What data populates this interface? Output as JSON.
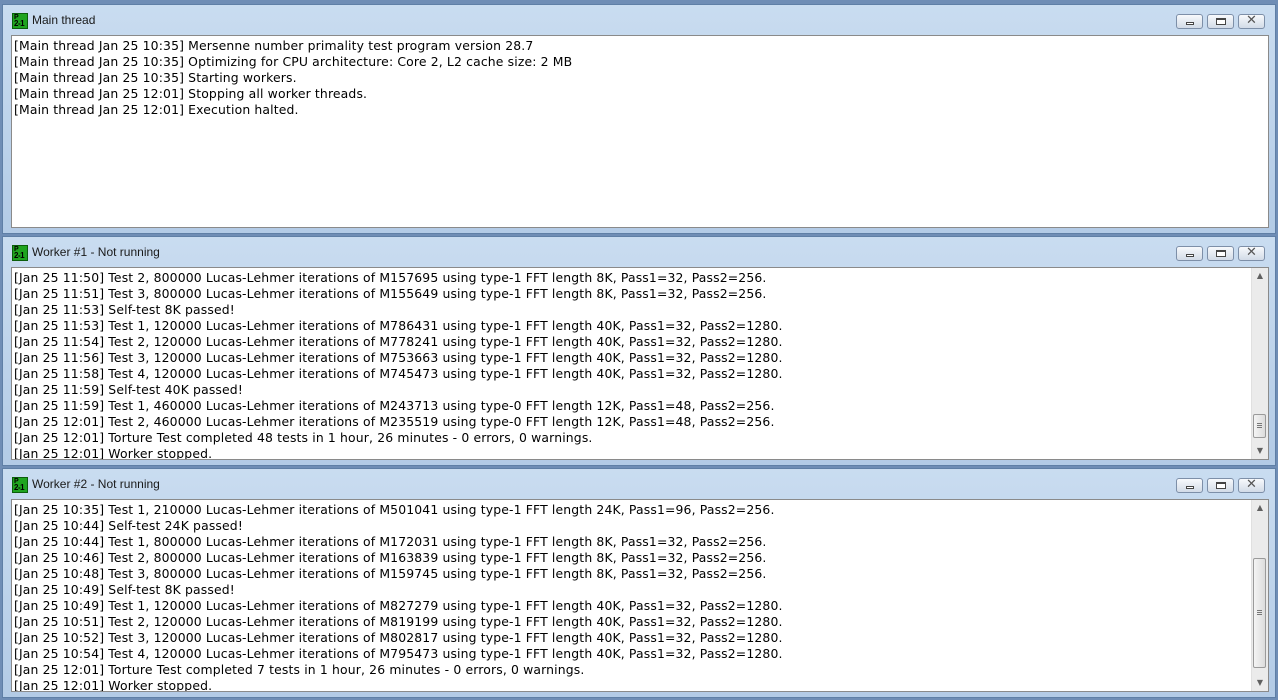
{
  "windows": [
    {
      "title": "Main thread",
      "lines": [
        "[Main thread Jan 25 10:35] Mersenne number primality test program version 28.7",
        "[Main thread Jan 25 10:35] Optimizing for CPU architecture: Core 2, L2 cache size: 2 MB",
        "[Main thread Jan 25 10:35] Starting workers.",
        "[Main thread Jan 25 12:01] Stopping all worker threads.",
        "[Main thread Jan 25 12:01] Execution halted."
      ]
    },
    {
      "title": "Worker #1 - Not running",
      "lines": [
        "[Jan 25 11:50] Test 2, 800000 Lucas-Lehmer iterations of M157695 using type-1 FFT length 8K, Pass1=32, Pass2=256.",
        "[Jan 25 11:51] Test 3, 800000 Lucas-Lehmer iterations of M155649 using type-1 FFT length 8K, Pass1=32, Pass2=256.",
        "[Jan 25 11:53] Self-test 8K passed!",
        "[Jan 25 11:53] Test 1, 120000 Lucas-Lehmer iterations of M786431 using type-1 FFT length 40K, Pass1=32, Pass2=1280.",
        "[Jan 25 11:54] Test 2, 120000 Lucas-Lehmer iterations of M778241 using type-1 FFT length 40K, Pass1=32, Pass2=1280.",
        "[Jan 25 11:56] Test 3, 120000 Lucas-Lehmer iterations of M753663 using type-1 FFT length 40K, Pass1=32, Pass2=1280.",
        "[Jan 25 11:58] Test 4, 120000 Lucas-Lehmer iterations of M745473 using type-1 FFT length 40K, Pass1=32, Pass2=1280.",
        "[Jan 25 11:59] Self-test 40K passed!",
        "[Jan 25 11:59] Test 1, 460000 Lucas-Lehmer iterations of M243713 using type-0 FFT length 12K, Pass1=48, Pass2=256.",
        "[Jan 25 12:01] Test 2, 460000 Lucas-Lehmer iterations of M235519 using type-0 FFT length 12K, Pass1=48, Pass2=256.",
        "[Jan 25 12:01] Torture Test completed 48 tests in 1 hour, 26 minutes - 0 errors, 0 warnings.",
        "[Jan 25 12:01] Worker stopped."
      ],
      "scroll_position": 0.98
    },
    {
      "title": "Worker #2 - Not running",
      "lines": [
        "[Jan 25 10:35] Test 1, 210000 Lucas-Lehmer iterations of M501041 using type-1 FFT length 24K, Pass1=96, Pass2=256.",
        "[Jan 25 10:44] Self-test 24K passed!",
        "[Jan 25 10:44] Test 1, 800000 Lucas-Lehmer iterations of M172031 using type-1 FFT length 8K, Pass1=32, Pass2=256.",
        "[Jan 25 10:46] Test 2, 800000 Lucas-Lehmer iterations of M163839 using type-1 FFT length 8K, Pass1=32, Pass2=256.",
        "[Jan 25 10:48] Test 3, 800000 Lucas-Lehmer iterations of M159745 using type-1 FFT length 8K, Pass1=32, Pass2=256.",
        "[Jan 25 10:49] Self-test 8K passed!",
        "[Jan 25 10:49] Test 1, 120000 Lucas-Lehmer iterations of M827279 using type-1 FFT length 40K, Pass1=32, Pass2=1280.",
        "[Jan 25 10:51] Test 2, 120000 Lucas-Lehmer iterations of M819199 using type-1 FFT length 40K, Pass1=32, Pass2=1280.",
        "[Jan 25 10:52] Test 3, 120000 Lucas-Lehmer iterations of M802817 using type-1 FFT length 40K, Pass1=32, Pass2=1280.",
        "[Jan 25 10:54] Test 4, 120000 Lucas-Lehmer iterations of M795473 using type-1 FFT length 40K, Pass1=32, Pass2=1280.",
        "[Jan 25 12:01] Torture Test completed 7 tests in 1 hour, 26 minutes - 0 errors, 0 warnings.",
        "[Jan 25 12:01] Worker stopped."
      ],
      "scroll_position": 0.98
    }
  ],
  "colors": {
    "app_icon": "#1fa41f",
    "title_bar": "#c9dcf0",
    "desktop": "#6f8db5"
  }
}
